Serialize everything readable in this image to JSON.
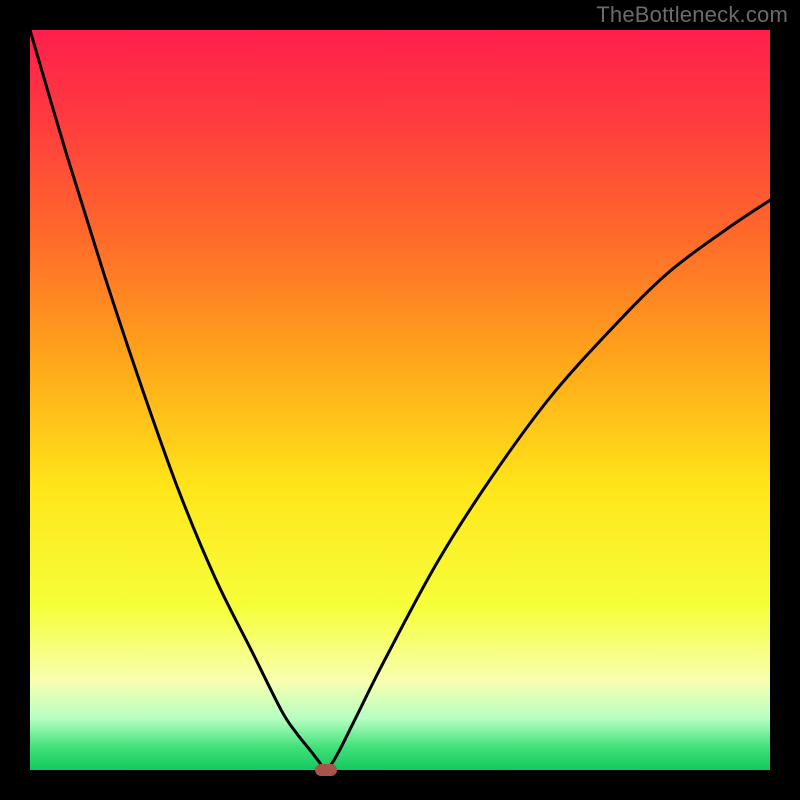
{
  "watermark": "TheBottleneck.com",
  "colors": {
    "background_black": "#000000",
    "gradient_stops": [
      {
        "offset": 0.0,
        "color": "#ff1f4b"
      },
      {
        "offset": 0.12,
        "color": "#ff3b3f"
      },
      {
        "offset": 0.28,
        "color": "#ff6a2a"
      },
      {
        "offset": 0.45,
        "color": "#ffa71a"
      },
      {
        "offset": 0.62,
        "color": "#ffe61a"
      },
      {
        "offset": 0.78,
        "color": "#f6ff3a"
      },
      {
        "offset": 0.88,
        "color": "#f7ffb0"
      },
      {
        "offset": 0.93,
        "color": "#b7ffc2"
      },
      {
        "offset": 0.97,
        "color": "#3fe07a"
      },
      {
        "offset": 1.0,
        "color": "#12c95e"
      }
    ],
    "curve": "#000000",
    "marker": "#a9534a"
  },
  "chart_data": {
    "type": "line",
    "title": "",
    "xlabel": "",
    "ylabel": "",
    "xlim": [
      0,
      100
    ],
    "ylim": [
      0,
      100
    ],
    "grid": false,
    "series": [
      {
        "name": "bottleneck-curve",
        "x": [
          0,
          5,
          10,
          15,
          20,
          25,
          30,
          34,
          36,
          38,
          39,
          40,
          41,
          42,
          44,
          48,
          55,
          62,
          70,
          78,
          86,
          94,
          100
        ],
        "y": [
          100,
          83,
          67,
          52,
          38,
          26,
          16,
          8,
          5,
          2.5,
          1.2,
          0,
          1.2,
          3,
          7,
          15,
          28,
          39,
          50,
          59,
          67,
          73,
          77
        ]
      }
    ],
    "annotations": [
      {
        "name": "bottleneck-marker",
        "x": 40,
        "y": 0
      }
    ],
    "legend": false
  }
}
